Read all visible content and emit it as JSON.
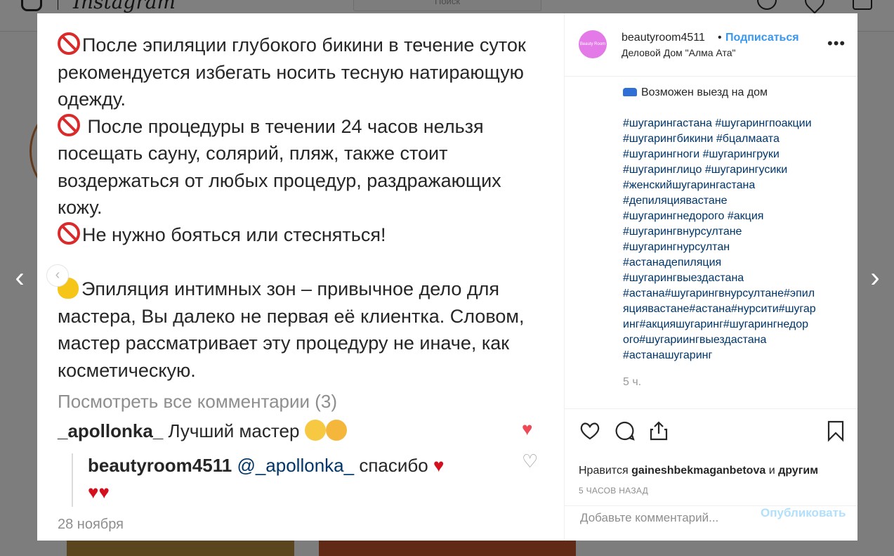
{
  "app": {
    "wordmark": "Instagram",
    "search_placeholder": "Поиск"
  },
  "media": {
    "paragraphs": [
      "После эпиляции глубокого бикини в течение суток рекомендуется избегать носить тесную натирающую одежду.",
      "После процедуры в течении 24 часов нельзя посещать сауну, солярий, пляж, также стоит воздержаться от любых процедур, раздражающих кожу.",
      "Не нужно бояться или стесняться!",
      "Эпиляция интимных зон – привычное дело для мастера, Вы далеко не первая её клиентка. Словом, мастер рассматривает эту процедуру не иначе, как косметическую."
    ],
    "view_comments": "Посмотреть все комментарии (3)",
    "comment1_user": "_apollonka_",
    "comment1_text": "Лучший мастер",
    "comment2_user": "beautyroom4511",
    "comment2_mention": "@_apollonka_",
    "comment2_text": "спасибо",
    "date": "28 ноября"
  },
  "post": {
    "username": "beautyroom4511",
    "separator": "•",
    "follow_label": "Подписаться",
    "location": "Деловой Дом \"Алма Ата\"",
    "avatar_text": "Beauty Room 4511",
    "caption_line1": "Возможен выезд на дом",
    "hashtags": [
      "#шугарингастана #шугарингпоакции",
      "#шугарингбикини #бцалмаата",
      "#шугарингноги #шугарингруки",
      "#шугаринглицо #шугарингусики",
      "#женскийшугарингастана",
      "#депиляциявастане",
      "#шугарингнедорого #акция",
      "#шугарингвнурсултане",
      "#шугарингнурсултан",
      "#астанадепиляция",
      "#шугарингвыездастана",
      "#астана#шугарингвнурсултане#эпил",
      "яциявастане#астана#нурсити#шугар",
      "инг#акцияшугаринг#шугарингнедор",
      "ого#шугариингвыездастана",
      "#астанашугаринг"
    ],
    "time_ago": "5 ч.",
    "likes_prefix": "Нравится",
    "likes_user": "gaineshbekmaganbetova",
    "likes_and": "и",
    "likes_others": "другим",
    "ago_small": "5 ЧАСОВ НАЗАД",
    "comment_placeholder": "Добавьте комментарий...",
    "publish_label": "Опубликовать"
  }
}
